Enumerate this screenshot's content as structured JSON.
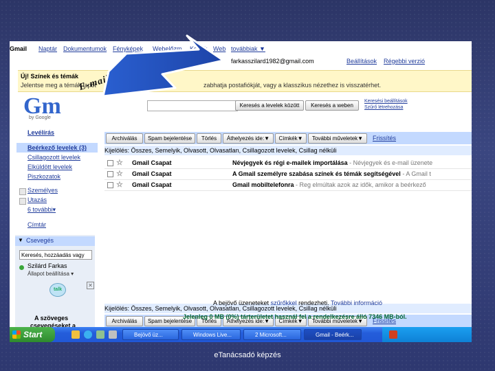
{
  "topnav": {
    "gmail": "Gmail",
    "calendar": "Naptár",
    "docs": "Dokumentumok",
    "photos": "Fényképek",
    "web_history": "Webelőzm.",
    "images": "Képek",
    "web": "Web",
    "more": "továbbiak ▼",
    "email": "farkasszilard1982@gmail.com",
    "settings": "Beállítások",
    "old_version": "Régebbi verzió"
  },
  "banner": {
    "title": "Új! Színek és témák",
    "body": "Jelentse meg a témák lapot",
    "body2": "zabhatja postafiókját, vagy a klasszikus nézethez is visszatérhet."
  },
  "logo": {
    "text": "Gm",
    "sub": "by Google"
  },
  "search": {
    "search_mail": "Keresés a levelek között",
    "search_web": "Keresés a weben",
    "options_link": "Keresési beállítások",
    "filter_link": "Szűrő létrehozása"
  },
  "annotation": "E-mail cím felépítése",
  "sidebar": {
    "compose": "Levélírás",
    "inbox": "Beérkező levelek (3)",
    "starred": "Csillagozott levelek",
    "sent": "Elküldött levelek",
    "drafts": "Piszkozatok",
    "personal": "Személyes",
    "travel": "Utazás",
    "more": "6 további▾",
    "contacts": "Címtár"
  },
  "chat": {
    "title": "Csevegés",
    "search_placeholder": "Keresés, hozzáadás vagy",
    "user": "Szilárd Farkas",
    "status": "Állapot beállítása ▾",
    "talk_text1": "A szöveges",
    "talk_text2": "csevegéseket a"
  },
  "toolbar": {
    "archive": "Archiválás",
    "spam": "Spam bejelentése",
    "delete": "Törlés",
    "move": "Áthelyezés ide:▼",
    "labels": "Címkék▼",
    "more": "További műveletek▼",
    "refresh": "Frissítés"
  },
  "select_row": "Kijelölés: Összes, Semelyik, Olvasott, Olvasatlan, Csillagozott levelek, Csillag nélküli",
  "emails": [
    {
      "from": "Gmail Csapat",
      "subject": "Névjegyek és régi e-mailek importálása",
      "snippet": " - Névjegyek és e-mail üzenete"
    },
    {
      "from": "Gmail Csapat",
      "subject": "A Gmail személyre szabása színek és témák segítségével",
      "snippet": " - A Gmail t"
    },
    {
      "from": "Gmail Csapat",
      "subject": "Gmail mobiltelefonra",
      "snippet": " - Reg elmúltak azok az idők, amikor a beérkező"
    }
  ],
  "footer": {
    "filters_pre": "A bejövő üzeneteket",
    "filters_link": "szűrőkkel",
    "filters_post": "rendezheti.",
    "more_info": "További információ",
    "quota": "Jelenleg 0 MB (0%) tárterületet használ fel a rendelkezésre álló 7346 MB-ból."
  },
  "taskbar": {
    "start": "Start",
    "tasks": [
      "Bejövő üz...",
      "Windows Live...",
      "2 Microsoft...",
      "Gmail - Beérk..."
    ]
  },
  "caption": "eTanácsadó képzés"
}
